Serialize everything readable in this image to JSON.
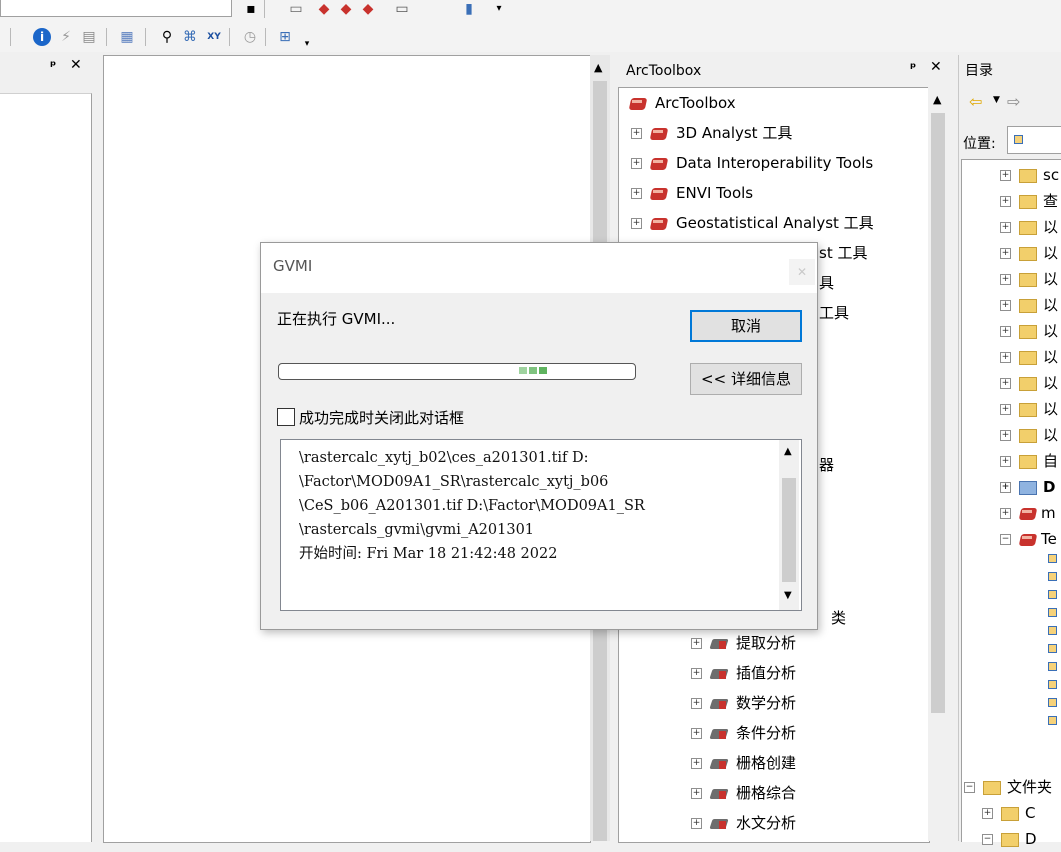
{
  "arctoolbox_panel": {
    "title": "ArcToolbox",
    "root": "ArcToolbox",
    "items": [
      "3D Analyst 工具",
      "Data Interoperability Tools",
      "ENVI Tools",
      "Geostatistical Analyst 工具"
    ],
    "partial_items": [
      "st 工具",
      "具",
      "工具",
      "器",
      "类"
    ],
    "sub_items": [
      "提取分析",
      "插值分析",
      "数学分析",
      "条件分析",
      "栅格创建",
      "栅格综合",
      "水文分析"
    ]
  },
  "catalog_panel": {
    "title": "目录",
    "location_label": "位置:",
    "partial_items": [
      "sc",
      "查",
      "以",
      "以",
      "以",
      "以",
      "以",
      "以",
      "以",
      "以",
      "以",
      "自",
      "D",
      "m",
      "Te"
    ],
    "bottom_items": [
      "文件夹",
      "C",
      "D"
    ]
  },
  "dialog": {
    "title": "GVMI",
    "status": "正在执行 GVMI...",
    "cancel_label": "取消",
    "details_label": "<< 详细信息",
    "close_checkbox_label": "成功完成时关闭此对话框",
    "progress": 0.8,
    "log_lines": [
      "\\rastercalc_xytj_b02\\ces_a201301.tif D:",
      "\\Factor\\MOD09A1_SR\\rastercalc_xytj_b06",
      "\\CeS_b06_A201301.tif D:\\Factor\\MOD09A1_SR",
      "\\rastercals_gvmi\\gvmi_A201301",
      "开始时间: Fri Mar 18 21:42:48 2022"
    ]
  }
}
